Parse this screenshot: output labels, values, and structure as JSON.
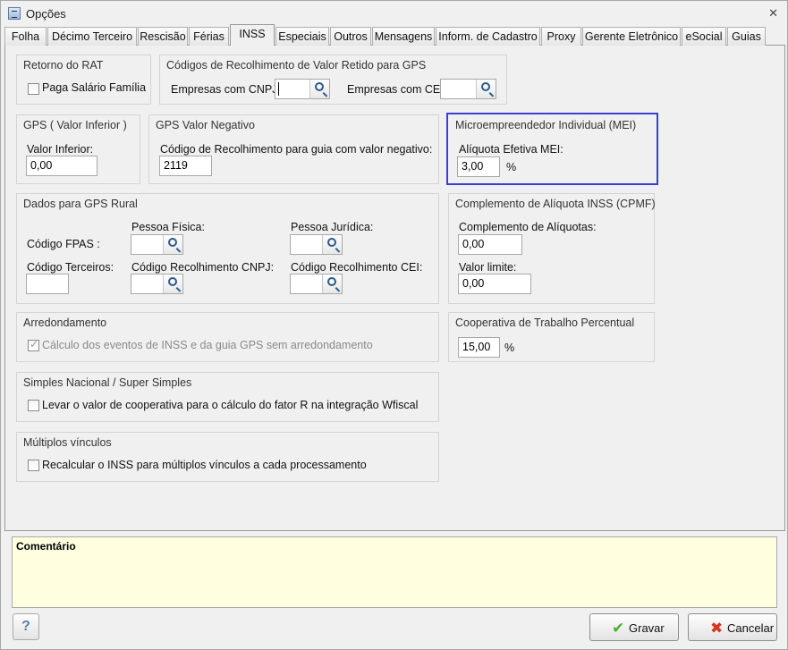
{
  "window": {
    "title": "Opções",
    "close_glyph": "✕"
  },
  "tabs": [
    {
      "label": "Folha"
    },
    {
      "label": "Décimo Terceiro"
    },
    {
      "label": "Rescisão"
    },
    {
      "label": "Férias"
    },
    {
      "label": "INSS",
      "active": true
    },
    {
      "label": "Especiais"
    },
    {
      "label": "Outros"
    },
    {
      "label": "Mensagens"
    },
    {
      "label": "Inform. de Cadastro"
    },
    {
      "label": "Proxy"
    },
    {
      "label": "Gerente Eletrônico"
    },
    {
      "label": "eSocial"
    },
    {
      "label": "Guias"
    }
  ],
  "retorno_rat": {
    "title": "Retorno do RAT",
    "paga_salario_familia": "Paga Salário Família"
  },
  "codigos_recolhimento": {
    "title": "Códigos de Recolhimento de Valor Retido para GPS",
    "empresas_cnpj_label": "Empresas com CNPJ:",
    "empresas_cnpj_value": "",
    "empresas_cei_label": "Empresas com CEI:",
    "empresas_cei_value": ""
  },
  "gps_valor_inferior": {
    "title": "GPS ( Valor Inferior )",
    "label": "Valor Inferior:",
    "value": "0,00"
  },
  "gps_valor_negativo": {
    "title": "GPS Valor Negativo",
    "label": "Código de Recolhimento para guia com valor negativo:",
    "value": "2119"
  },
  "mei": {
    "title": "Microempreendedor Individual (MEI)",
    "label": "Alíquota Efetiva MEI:",
    "value": "3,00",
    "unit": "%"
  },
  "gps_rural": {
    "title": "Dados para GPS Rural",
    "codigo_fpas": "Código FPAS :",
    "codigo_terceiros": "Código Terceiros:",
    "pessoa_fisica": "Pessoa Física:",
    "pessoa_juridica": "Pessoa Jurídica:",
    "recolhimento_cnpj": "Código Recolhimento CNPJ:",
    "recolhimento_cei": "Código Recolhimento CEI:"
  },
  "cpmf": {
    "title": "Complemento de Alíquota INSS (CPMF)",
    "complemento_label": "Complemento de Alíquotas:",
    "complemento_value": "0,00",
    "limite_label": "Valor limite:",
    "limite_value": "0,00"
  },
  "arredondamento": {
    "title": "Arredondamento",
    "option": "Cálculo dos eventos de INSS e da guia GPS sem arredondamento",
    "checked": true
  },
  "cooperativa": {
    "title": "Cooperativa de Trabalho Percentual",
    "value": "15,00",
    "unit": "%"
  },
  "simples": {
    "title": "Simples Nacional / Super Simples",
    "option": "Levar o valor de cooperativa para o cálculo do fator R na integração Wfiscal"
  },
  "multiplos": {
    "title": "Múltiplos vínculos",
    "option": "Recalcular o INSS para múltiplos vínculos a cada processamento"
  },
  "comment": {
    "title": "Comentário"
  },
  "footer": {
    "help": "?",
    "save_label": "Gravar",
    "cancel_label": "Cancelar"
  },
  "icons": {
    "app": "app-icon",
    "close": "close-icon",
    "lookup": "search-icon",
    "save": "check-icon",
    "cancel": "x-icon",
    "help": "help-icon"
  },
  "colors": {
    "mei_highlight": "#3b3fd0",
    "comment_bg": "#ffffe0",
    "save_icon": "#4caf2e",
    "cancel_icon": "#d9331f"
  }
}
